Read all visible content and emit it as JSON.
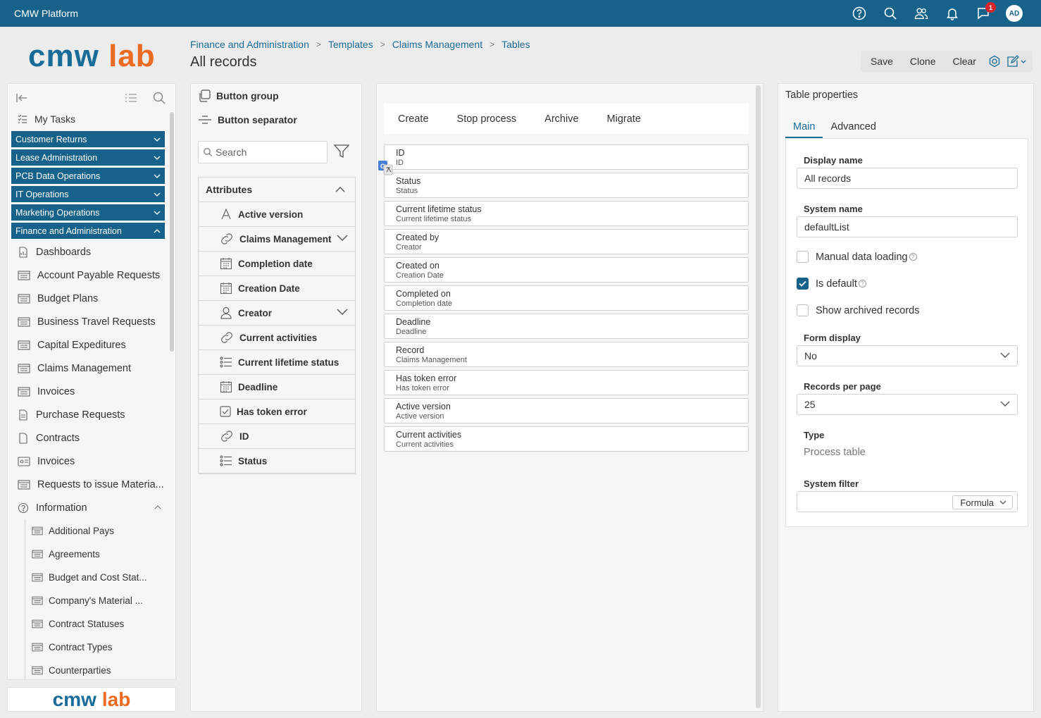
{
  "app": {
    "title": "CMW Platform",
    "notifications_count": "1",
    "user_initials": "AD"
  },
  "logo": {
    "part1": "cmw",
    "part2": "lab"
  },
  "breadcrumb": [
    "Finance and Administration",
    "Templates",
    "Claims Management",
    "Tables"
  ],
  "page_title": "All records",
  "toolbar": {
    "save": "Save",
    "clone": "Clone",
    "clear": "Clear"
  },
  "sidebar": {
    "my_tasks": "My Tasks",
    "groups": [
      "Customer Returns",
      "Lease Administration",
      "PCB Data Operations",
      "IT Operations",
      "Marketing Operations",
      "Finance and Administration"
    ],
    "items": [
      "Dashboards",
      "Account Payable Requests",
      "Budget Plans",
      "Business Travel Requests",
      "Capital Expeditures",
      "Claims Management",
      "Invoices",
      "Purchase Requests",
      "Contracts",
      "Invoices",
      "Requests to issue Materia...",
      "Information"
    ],
    "subitems": [
      "Additional Pays",
      "Agreements",
      "Budget and Cost Stat...",
      "Company's Material ...",
      "Contract Statuses",
      "Contract Types",
      "Counterparties"
    ]
  },
  "palette": {
    "button_group": "Button group",
    "button_separator": "Button separator",
    "search_placeholder": "Search",
    "attributes_title": "Attributes",
    "attributes": [
      "Active version",
      "Claims Management",
      "Completion date",
      "Creation Date",
      "Creator",
      "Current activities",
      "Current lifetime status",
      "Deadline",
      "Has token error",
      "ID",
      "Status"
    ]
  },
  "canvas": {
    "buttons": [
      "Create",
      "Stop process",
      "Archive",
      "Migrate"
    ],
    "columns": [
      {
        "name": "ID",
        "sub": "ID"
      },
      {
        "name": "Status",
        "sub": "Status"
      },
      {
        "name": "Current lifetime status",
        "sub": "Current lifetime status"
      },
      {
        "name": "Created by",
        "sub": "Creator"
      },
      {
        "name": "Created on",
        "sub": "Creation Date"
      },
      {
        "name": "Completed on",
        "sub": "Completion date"
      },
      {
        "name": "Deadline",
        "sub": "Deadline"
      },
      {
        "name": "Record",
        "sub": "Claims Management"
      },
      {
        "name": "Has token error",
        "sub": "Has token error"
      },
      {
        "name": "Active version",
        "sub": "Active version"
      },
      {
        "name": "Current activities",
        "sub": "Current activities"
      }
    ]
  },
  "props": {
    "title": "Table properties",
    "tabs": [
      "Main",
      "Advanced"
    ],
    "display_name_label": "Display name",
    "display_name": "All records",
    "system_name_label": "System name",
    "system_name": "defaultList",
    "manual_loading": "Manual data loading",
    "is_default": "Is default",
    "show_archived": "Show archived records",
    "form_display_label": "Form display",
    "form_display": "No",
    "records_per_page_label": "Records per page",
    "records_per_page": "25",
    "type_label": "Type",
    "type_value": "Process table",
    "system_filter_label": "System filter",
    "formula": "Formula"
  }
}
